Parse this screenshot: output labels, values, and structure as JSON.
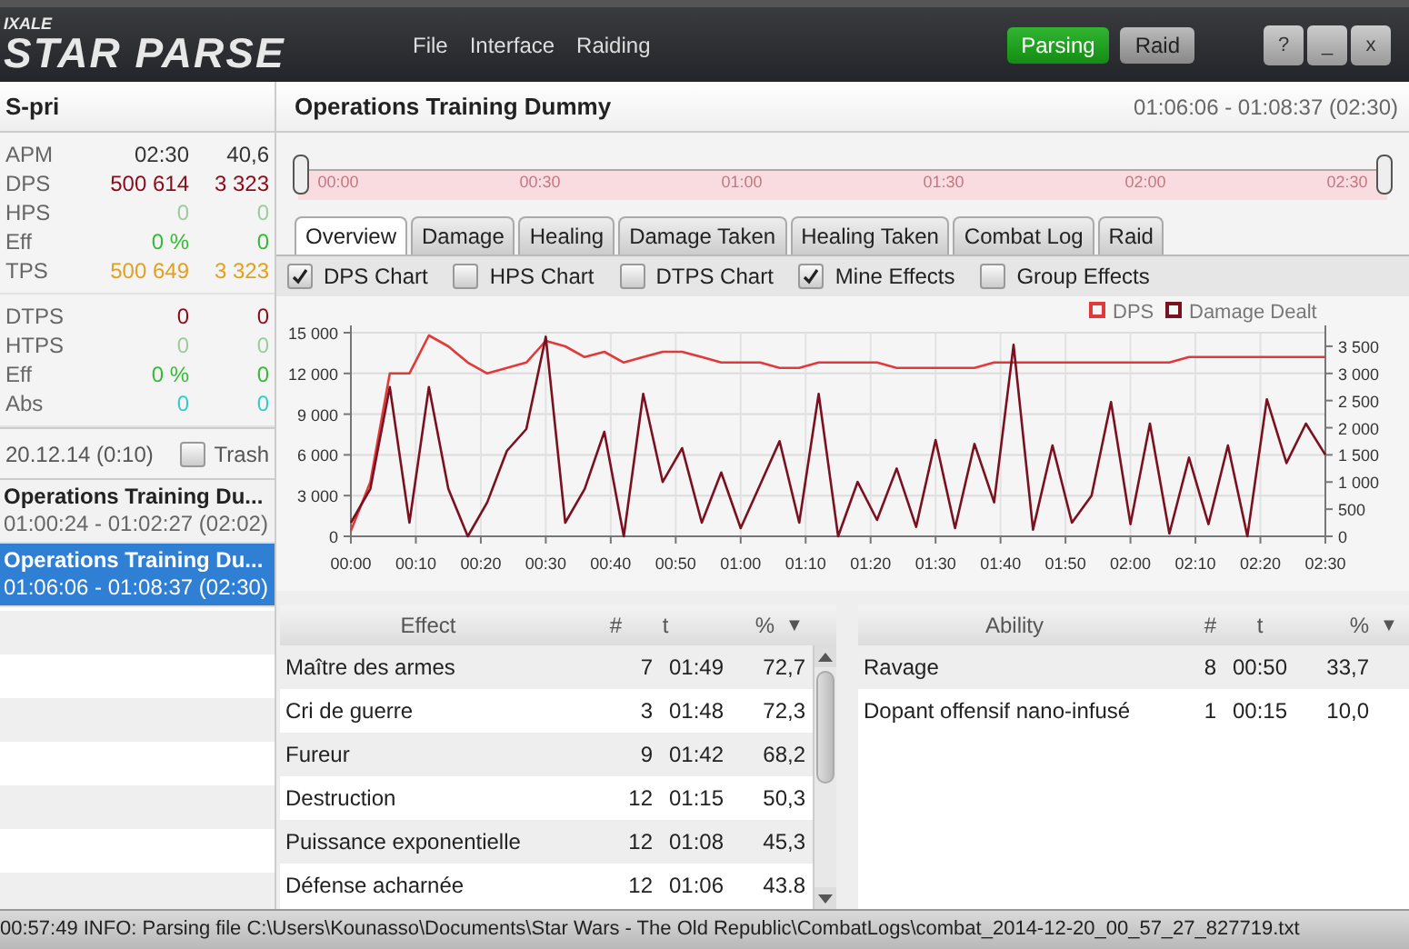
{
  "app": {
    "logo_small": "IXALE",
    "logo": "STAR PARSE"
  },
  "menu": [
    "File",
    "Interface",
    "Raiding"
  ],
  "mode_buttons": [
    {
      "label": "Parsing",
      "selected": true
    },
    {
      "label": "Raid",
      "selected": false
    }
  ],
  "window_buttons": [
    "?",
    "_",
    "x"
  ],
  "character": "S-pri",
  "stats_groups": [
    [
      {
        "label": "APM",
        "value": "02:30",
        "rate": "40,6",
        "color": "#333333"
      },
      {
        "label": "DPS",
        "value": "500 614",
        "rate": "3 323",
        "color": "#8b0a1a"
      },
      {
        "label": "HPS",
        "value": "0",
        "rate": "0",
        "color": "#9ccc9c"
      },
      {
        "label": "Eff",
        "value": "0 %",
        "rate": "0",
        "color": "#33bb33"
      },
      {
        "label": "TPS",
        "value": "500 649",
        "rate": "3 323",
        "color": "#e0a020"
      }
    ],
    [
      {
        "label": "DTPS",
        "value": "0",
        "rate": "0",
        "color": "#8b0a1a"
      },
      {
        "label": "HTPS",
        "value": "0",
        "rate": "0",
        "color": "#9ccc9c"
      },
      {
        "label": "Eff",
        "value": "0 %",
        "rate": "0",
        "color": "#33bb33"
      },
      {
        "label": "Abs",
        "value": "0",
        "rate": "0",
        "color": "#33cccc"
      }
    ]
  ],
  "session": {
    "date": "20.12.14 (0:10)",
    "trash_label": "Trash",
    "trash_checked": false
  },
  "combats": [
    {
      "name": "Operations Training Du...",
      "time": "01:00:24 - 01:02:27 (02:02)",
      "selected": false
    },
    {
      "name": "Operations Training Du...",
      "time": "01:06:06 - 01:08:37 (02:30)",
      "selected": true
    }
  ],
  "encounter": {
    "title": "Operations Training Dummy",
    "time": "01:06:06 - 01:08:37 (02:30)"
  },
  "timeline": {
    "ticks": [
      "00:00",
      "00:30",
      "01:00",
      "01:30",
      "02:00",
      "02:30"
    ]
  },
  "tabs": [
    {
      "label": "Overview",
      "selected": true
    },
    {
      "label": "Damage",
      "selected": false
    },
    {
      "label": "Healing",
      "selected": false
    },
    {
      "label": "Damage Taken",
      "selected": false
    },
    {
      "label": "Healing Taken",
      "selected": false
    },
    {
      "label": "Combat Log",
      "selected": false
    },
    {
      "label": "Raid",
      "selected": false
    }
  ],
  "options": [
    {
      "label": "DPS Chart",
      "checked": true
    },
    {
      "label": "HPS Chart",
      "checked": false
    },
    {
      "label": "DTPS Chart",
      "checked": false
    },
    {
      "label": "Mine Effects",
      "checked": true
    },
    {
      "label": "Group Effects",
      "checked": false
    }
  ],
  "chart_data": {
    "type": "line",
    "grid": true,
    "legend": "top-right",
    "x": [
      0,
      3,
      6,
      9,
      12,
      15,
      18,
      21,
      24,
      27,
      30,
      33,
      36,
      39,
      42,
      45,
      48,
      51,
      54,
      57,
      60,
      63,
      66,
      69,
      72,
      75,
      78,
      81,
      84,
      87,
      90,
      93,
      96,
      99,
      102,
      105,
      108,
      111,
      114,
      117,
      120,
      123,
      126,
      129,
      132,
      135,
      138,
      141,
      144,
      147,
      150
    ],
    "xlim": [
      0,
      150
    ],
    "xticks": [
      {
        "value": 0,
        "label": "00:00"
      },
      {
        "value": 10,
        "label": "00:10"
      },
      {
        "value": 20,
        "label": "00:20"
      },
      {
        "value": 30,
        "label": "00:30"
      },
      {
        "value": 40,
        "label": "00:40"
      },
      {
        "value": 50,
        "label": "00:50"
      },
      {
        "value": 60,
        "label": "01:00"
      },
      {
        "value": 70,
        "label": "01:10"
      },
      {
        "value": 80,
        "label": "01:20"
      },
      {
        "value": 90,
        "label": "01:30"
      },
      {
        "value": 100,
        "label": "01:40"
      },
      {
        "value": 110,
        "label": "01:50"
      },
      {
        "value": 120,
        "label": "02:00"
      },
      {
        "value": 130,
        "label": "02:10"
      },
      {
        "value": 140,
        "label": "02:20"
      },
      {
        "value": 150,
        "label": "02:30"
      }
    ],
    "ylim": [
      0,
      15000
    ],
    "yticks": [
      {
        "value": 0,
        "label": "0"
      },
      {
        "value": 3000,
        "label": "3 000"
      },
      {
        "value": 6000,
        "label": "6 000"
      },
      {
        "value": 9000,
        "label": "9 000"
      },
      {
        "value": 12000,
        "label": "12 000"
      },
      {
        "value": 15000,
        "label": "15 000"
      }
    ],
    "y2lim": [
      0,
      3750
    ],
    "y2ticks": [
      {
        "value": 0,
        "label": "0"
      },
      {
        "value": 500,
        "label": "500"
      },
      {
        "value": 1000,
        "label": "1 000"
      },
      {
        "value": 1500,
        "label": "1 500"
      },
      {
        "value": 2000,
        "label": "2 000"
      },
      {
        "value": 2500,
        "label": "2 500"
      },
      {
        "value": 3000,
        "label": "3 000"
      },
      {
        "value": 3500,
        "label": "3 500"
      }
    ],
    "series": [
      {
        "name": "DPS",
        "color": "#e03a3a",
        "axis": "y2",
        "values": [
          100,
          1000,
          3000,
          3000,
          3700,
          3500,
          3200,
          3000,
          3100,
          3200,
          3600,
          3500,
          3300,
          3400,
          3200,
          3300,
          3400,
          3400,
          3300,
          3200,
          3200,
          3200,
          3100,
          3100,
          3200,
          3200,
          3200,
          3200,
          3100,
          3100,
          3100,
          3100,
          3100,
          3200,
          3200,
          3200,
          3200,
          3200,
          3200,
          3200,
          3200,
          3200,
          3200,
          3300,
          3300,
          3300,
          3300,
          3300,
          3300,
          3300,
          3300
        ]
      },
      {
        "name": "Damage Dealt",
        "color": "#7a1020",
        "values": [
          1000,
          3500,
          11000,
          1000,
          11000,
          3500,
          0,
          2500,
          6300,
          7900,
          14700,
          1000,
          3500,
          7700,
          0,
          10500,
          4000,
          6500,
          1000,
          4700,
          600,
          3800,
          7000,
          1000,
          10500,
          0,
          4000,
          1200,
          5000,
          700,
          7100,
          600,
          6800,
          2500,
          14100,
          500,
          6700,
          1000,
          3000,
          9900,
          900,
          8300,
          200,
          5800,
          900,
          6700,
          0,
          10100,
          5400,
          8300,
          6000
        ]
      }
    ]
  },
  "effects": {
    "columns": [
      "Effect",
      "#",
      "t",
      "%"
    ],
    "sort_mark": "▼",
    "rows": [
      [
        "Maître des armes",
        "7",
        "01:49",
        "72,7"
      ],
      [
        "Cri de guerre",
        "3",
        "01:48",
        "72,3"
      ],
      [
        "Fureur",
        "9",
        "01:42",
        "68,2"
      ],
      [
        "Destruction",
        "12",
        "01:15",
        "50,3"
      ],
      [
        "Puissance exponentielle",
        "12",
        "01:08",
        "45,3"
      ],
      [
        "Défense acharnée",
        "12",
        "01:06",
        "43.8"
      ]
    ]
  },
  "abilities": {
    "columns": [
      "Ability",
      "#",
      "t",
      "%"
    ],
    "sort_mark": "▼",
    "rows": [
      [
        "Ravage",
        "8",
        "00:50",
        "33,7"
      ],
      [
        "Dopant offensif nano-infusé",
        "1",
        "00:15",
        "10,0"
      ]
    ]
  },
  "status_bar": "00:57:49 INFO: Parsing file C:\\Users\\Kounasso\\Documents\\Star Wars - The Old Republic\\CombatLogs\\combat_2014-12-20_00_57_27_827719.txt"
}
